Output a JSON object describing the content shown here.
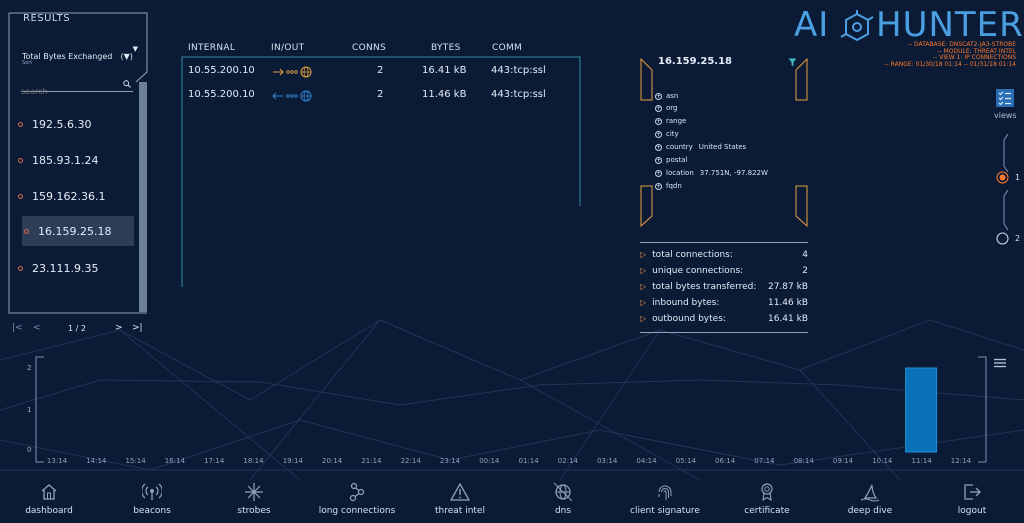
{
  "results": {
    "title": "RESULTS",
    "sort_value": "Total Bytes Exchanged",
    "sort_badge": "(▼)",
    "sort_caption": "Sort",
    "search_placeholder": "search",
    "items": [
      "192.5.6.30",
      "185.93.1.24",
      "159.162.36.1",
      "16.159.25.18",
      "23.111.9.35"
    ],
    "selected_index": 3
  },
  "pagination": {
    "page": "1 / 2"
  },
  "table": {
    "headers": [
      "INTERNAL",
      "IN/OUT",
      "CONNS",
      "BYTES",
      "COMM"
    ],
    "rows": [
      {
        "internal": "10.55.200.10",
        "direction": "out",
        "conns": "2",
        "bytes": "16.41 kB",
        "comm": "443:tcp:ssl"
      },
      {
        "internal": "10.55.200.10",
        "direction": "in",
        "conns": "2",
        "bytes": "11.46 kB",
        "comm": "443:tcp:ssl"
      }
    ]
  },
  "detail": {
    "ip": "16.159.25.18",
    "attributes": [
      {
        "key": "asn",
        "value": ""
      },
      {
        "key": "org",
        "value": ""
      },
      {
        "key": "range",
        "value": ""
      },
      {
        "key": "city",
        "value": ""
      },
      {
        "key": "country",
        "value": "United States"
      },
      {
        "key": "postal",
        "value": ""
      },
      {
        "key": "location",
        "value": "37.751N, -97.822W"
      },
      {
        "key": "fqdn",
        "value": ""
      }
    ],
    "stats": [
      {
        "label": "total connections:",
        "value": "4"
      },
      {
        "label": "unique connections:",
        "value": "2"
      },
      {
        "label": "total bytes transferred:",
        "value": "27.87 kB"
      },
      {
        "label": "inbound bytes:",
        "value": "11.46 kB"
      },
      {
        "label": "outbound bytes:",
        "value": "16.41 kB"
      }
    ]
  },
  "brand": {
    "logo_left": "AI",
    "logo_right": "HUNTER",
    "info": [
      "-- DATABASE: DNSCAT2-JA3-STROBE",
      "-- MODULE: THREAT INTEL",
      "-- VIEW 1: IP CONNECTIONS",
      "-- RANGE: 01/30/18 01:14 -- 01/31/18 01:14"
    ]
  },
  "views": {
    "label": "views",
    "options": [
      "1",
      "2"
    ],
    "selected": "1"
  },
  "timeline": {
    "ticks": [
      "13:14",
      "14:14",
      "15:14",
      "16:14",
      "17:14",
      "18:14",
      "19:14",
      "20:14",
      "21:14",
      "22:14",
      "23:14",
      "00:14",
      "01:14",
      "02:14",
      "03:14",
      "04:14",
      "05:14",
      "06:14",
      "07:14",
      "08:14",
      "09:14",
      "10:14",
      "11:14",
      "12:14"
    ],
    "y_ticks": [
      "2",
      "1",
      "0"
    ],
    "values": [
      0,
      0,
      0,
      0,
      0,
      0,
      0,
      0,
      0,
      0,
      0,
      0,
      0,
      0,
      0,
      0,
      0,
      0,
      0,
      0,
      0,
      0,
      2,
      0
    ],
    "ymax": 2
  },
  "nav": [
    {
      "label": "dashboard",
      "icon": "home-icon"
    },
    {
      "label": "beacons",
      "icon": "beacon-icon"
    },
    {
      "label": "strobes",
      "icon": "strobe-icon"
    },
    {
      "label": "long connections",
      "icon": "long-connections-icon"
    },
    {
      "label": "threat intel",
      "icon": "warning-icon"
    },
    {
      "label": "dns",
      "icon": "dns-globe-icon"
    },
    {
      "label": "client signature",
      "icon": "fingerprint-icon"
    },
    {
      "label": "certificate",
      "icon": "certificate-icon"
    },
    {
      "label": "deep dive",
      "icon": "shark-fin-icon"
    },
    {
      "label": "logout",
      "icon": "logout-icon"
    }
  ],
  "colors": {
    "accent_orange": "#e8a040",
    "accent_blue": "#2f86d6",
    "bar_blue": "#0a72b8",
    "teal": "#3fb7c6",
    "brand_orange": "#ff7a2a"
  }
}
